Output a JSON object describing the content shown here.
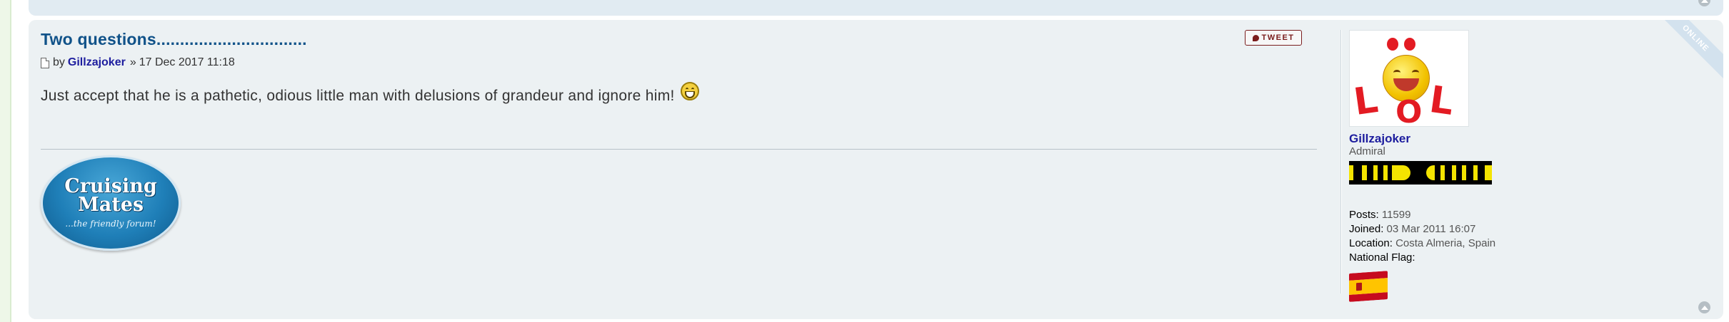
{
  "post": {
    "title": "Two questions................................",
    "meta": {
      "by_label": "by",
      "author": "Gillzajoker",
      "separator": "»",
      "date": "17 Dec 2017 11:18"
    },
    "content": "Just accept that he is a pathetic, odious little man with delusions of grandeur and ignore him!",
    "tweet_label": "TWEET",
    "online_label": "ONLINE",
    "signature": {
      "line1": "Cruising",
      "line2": "Mates",
      "tagline": "...the friendly forum!"
    }
  },
  "profile": {
    "avatar_text": "LOL",
    "username": "Gillzajoker",
    "rank": "Admiral",
    "details": [
      {
        "label": "Posts:",
        "value": "11599"
      },
      {
        "label": "Joined:",
        "value": "03 Mar 2011 16:07"
      },
      {
        "label": "Location:",
        "value": "Costa Almeria, Spain"
      },
      {
        "label": "National Flag:",
        "value": ""
      }
    ],
    "flag": "spain-flag"
  },
  "colors": {
    "post_background": "#ecf1f3",
    "title": "#105289",
    "username": "#1d1d9e",
    "tweet_border": "#7a1d1d"
  }
}
